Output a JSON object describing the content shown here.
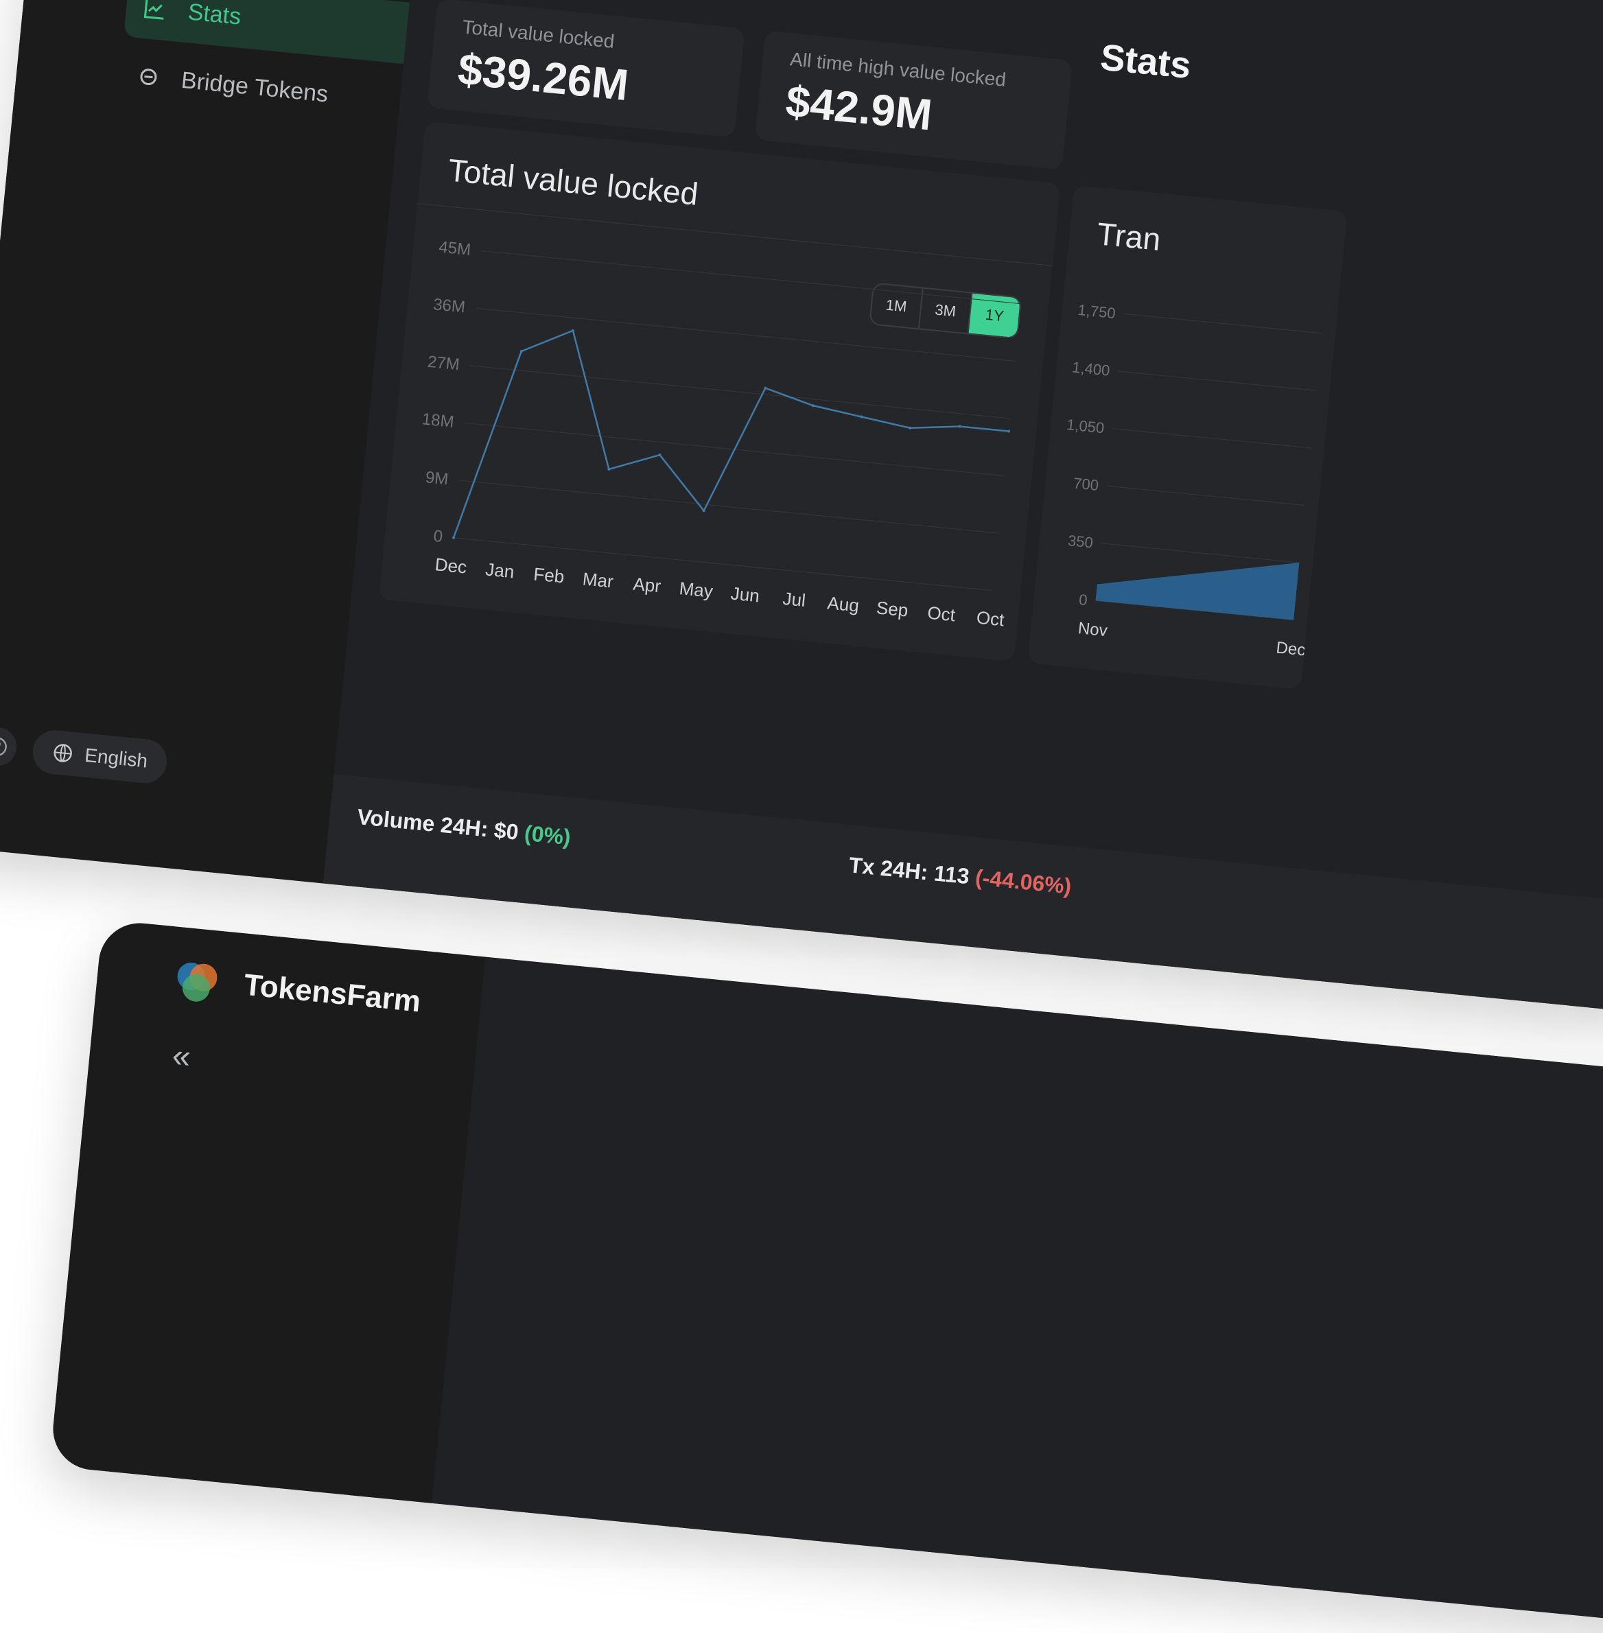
{
  "sidebar": {
    "items": [
      {
        "label": "Stats",
        "icon": "chart-line-icon",
        "active": true
      },
      {
        "label": "Bridge Tokens",
        "icon": "bridge-icon",
        "active": false
      }
    ],
    "language": "English"
  },
  "cards": {
    "tvl": {
      "label": "Total value locked",
      "value": "$39.26M"
    },
    "ath": {
      "label": "All time high value locked",
      "value": "$42.9M"
    }
  },
  "stats_title": "Stats",
  "chart_main": {
    "title": "Total value locked",
    "ranges": [
      "1M",
      "3M",
      "1Y"
    ],
    "active_range": "1Y",
    "y_ticks": [
      "0",
      "9M",
      "18M",
      "27M",
      "36M",
      "45M"
    ],
    "x_ticks": [
      "Dec",
      "Jan",
      "Feb",
      "Mar",
      "Apr",
      "May",
      "Jun",
      "Jul",
      "Aug",
      "Sep",
      "Oct",
      "Oct"
    ]
  },
  "chart_side": {
    "title": "Tran",
    "y_ticks": [
      "0",
      "350",
      "700",
      "1,050",
      "1,400",
      "1,750"
    ],
    "x_ticks": [
      "Nov",
      "Dec"
    ]
  },
  "footer": {
    "volume": {
      "label": "Volume 24H: $0",
      "change": "(0%)"
    },
    "tx": {
      "label": "Tx 24H: 113",
      "change": "(-44.06%)"
    }
  },
  "screen2": {
    "brand": "TokensFarm"
  },
  "colors": {
    "accent": "#41c98a",
    "negative": "#e06461",
    "line": "#3f7aa8"
  },
  "chart_data": [
    {
      "type": "line",
      "title": "Total value locked",
      "categories": [
        "Dec",
        "Jan",
        "Feb",
        "Mar",
        "Apr",
        "May",
        "Jun",
        "Jul",
        "Aug",
        "Sep",
        "Oct",
        "Oct"
      ],
      "values": [
        0,
        30,
        34,
        13,
        16,
        8,
        28,
        26,
        25,
        24,
        25,
        25
      ],
      "ylim": [
        0,
        45
      ],
      "y_unit": "M",
      "grid": true
    },
    {
      "type": "area",
      "title": "Tran",
      "categories": [
        "Nov",
        "Dec"
      ],
      "values": [
        100,
        350
      ],
      "ylim": [
        0,
        1750
      ],
      "grid": true
    }
  ]
}
